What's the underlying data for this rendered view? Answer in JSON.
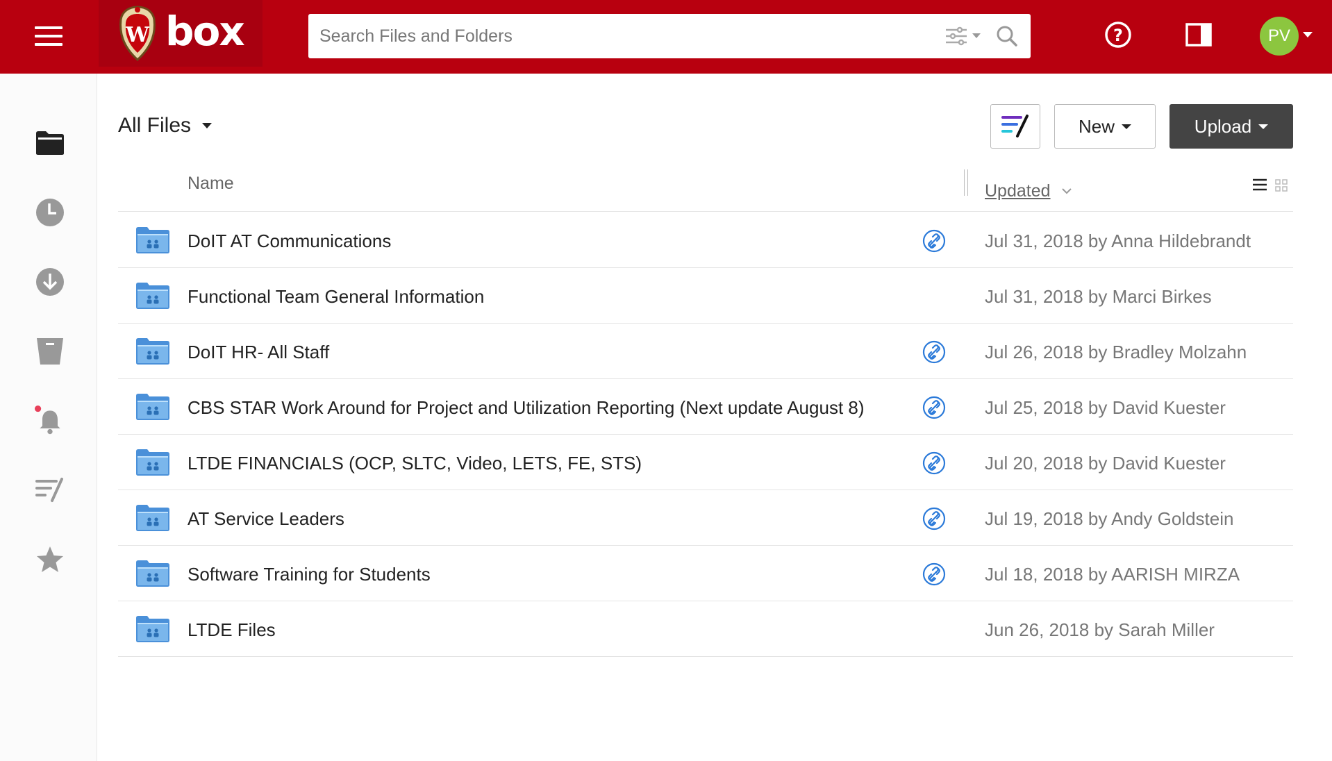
{
  "header": {
    "logo_text": "box",
    "search_placeholder": "Search Files and Folders",
    "avatar_initials": "PV",
    "brand_color": "#b8000f"
  },
  "sidebar": {
    "items": [
      {
        "name": "all-files",
        "icon": "folder-icon"
      },
      {
        "name": "recents",
        "icon": "clock-icon"
      },
      {
        "name": "synced",
        "icon": "download-icon"
      },
      {
        "name": "trash",
        "icon": "trash-icon"
      },
      {
        "name": "notifications",
        "icon": "bell-icon"
      },
      {
        "name": "notes",
        "icon": "notes-icon"
      },
      {
        "name": "favorites",
        "icon": "star-icon"
      }
    ]
  },
  "main": {
    "title": "All Files",
    "new_label": "New",
    "upload_label": "Upload",
    "col_name": "Name",
    "col_updated": "Updated"
  },
  "files": [
    {
      "name": "DoIT AT Communications",
      "shared_link": true,
      "updated": "Jul 31, 2018 by Anna Hildebrandt"
    },
    {
      "name": "Functional Team General Information",
      "shared_link": false,
      "updated": "Jul 31, 2018 by Marci Birkes"
    },
    {
      "name": "DoIT HR- All Staff",
      "shared_link": true,
      "updated": "Jul 26, 2018 by Bradley Molzahn"
    },
    {
      "name": "CBS STAR Work Around for Project and Utilization Reporting (Next update August 8)",
      "shared_link": true,
      "updated": "Jul 25, 2018 by David Kuester"
    },
    {
      "name": "LTDE FINANCIALS (OCP, SLTC, Video, LETS, FE, STS)",
      "shared_link": true,
      "updated": "Jul 20, 2018 by David Kuester"
    },
    {
      "name": "AT Service Leaders",
      "shared_link": true,
      "updated": "Jul 19, 2018 by Andy Goldstein"
    },
    {
      "name": "Software Training for Students",
      "shared_link": true,
      "updated": "Jul 18, 2018 by AARISH MIRZA"
    },
    {
      "name": "LTDE Files",
      "shared_link": false,
      "updated": "Jun 26, 2018 by Sarah Miller"
    }
  ]
}
